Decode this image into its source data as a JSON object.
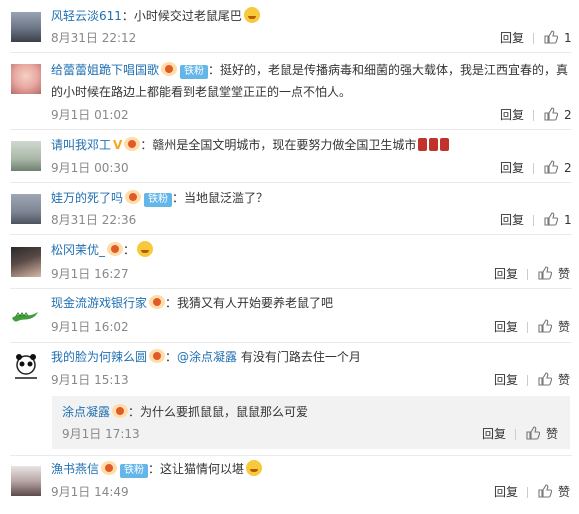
{
  "comments": [
    {
      "name": "风轻云淡611",
      "sep": "：",
      "text": "小时候交过老鼠尾巴",
      "date": "8月31日 22:12",
      "reply": "回复",
      "like": "1"
    },
    {
      "name": "给蕾蕾姐跪下唱国歌",
      "fan": "铁粉",
      "sep": "：",
      "text": "挺好的，老鼠是传播病毒和细菌的强大载体，我是江西宜春的，真的小时候在路边上都能看到老鼠堂堂正正的一点不怕人。",
      "date": "9月1日 01:02",
      "reply": "回复",
      "like": "2"
    },
    {
      "name": "请叫我邓工",
      "sep": "：",
      "text": "赣州是全国文明城市，现在要努力做全国卫生城市",
      "date": "9月1日 00:30",
      "reply": "回复",
      "like": "2"
    },
    {
      "name": "娃万的死了吗",
      "fan": "铁粉",
      "sep": "：",
      "text": "当地鼠泛滥了？",
      "date": "8月31日 22:36",
      "reply": "回复",
      "like": "1"
    },
    {
      "name": "松冈茉优_",
      "sep": "：",
      "text": "",
      "date": "9月1日 16:27",
      "reply": "回复",
      "like": "赞"
    },
    {
      "name": "现金流游戏银行家",
      "sep": "：",
      "text": "我猜又有人开始要养老鼠了吧",
      "date": "9月1日 16:02",
      "reply": "回复",
      "like": "赞"
    },
    {
      "name": "我的脸为何辣么圆",
      "sep": "：",
      "at": "@涂点凝露",
      "text": " 有没有门路去住一个月",
      "date": "9月1日 15:13",
      "reply": "回复",
      "like": "赞"
    },
    {
      "name": "漁书燕信",
      "fan": "铁粉",
      "sep": "：",
      "text": "这让猫情何以堪",
      "date": "9月1日 14:49",
      "reply": "回复",
      "like": "赞"
    }
  ],
  "child_reply": {
    "name": "涂点凝露",
    "sep": "：",
    "text": "为什么要抓鼠鼠，鼠鼠那么可爱",
    "date": "9月1日 17:13",
    "reply": "回复",
    "like": "赞"
  },
  "colors": {
    "name": "#1f6fb2",
    "fan_badge": "#64b5e8",
    "background": "#ffffff"
  },
  "icons": [
    "thumbs-up-icon",
    "smiley-emoji-icon",
    "red-packet-emoji-icon",
    "vip-badge-icon",
    "verified-v-icon"
  ]
}
